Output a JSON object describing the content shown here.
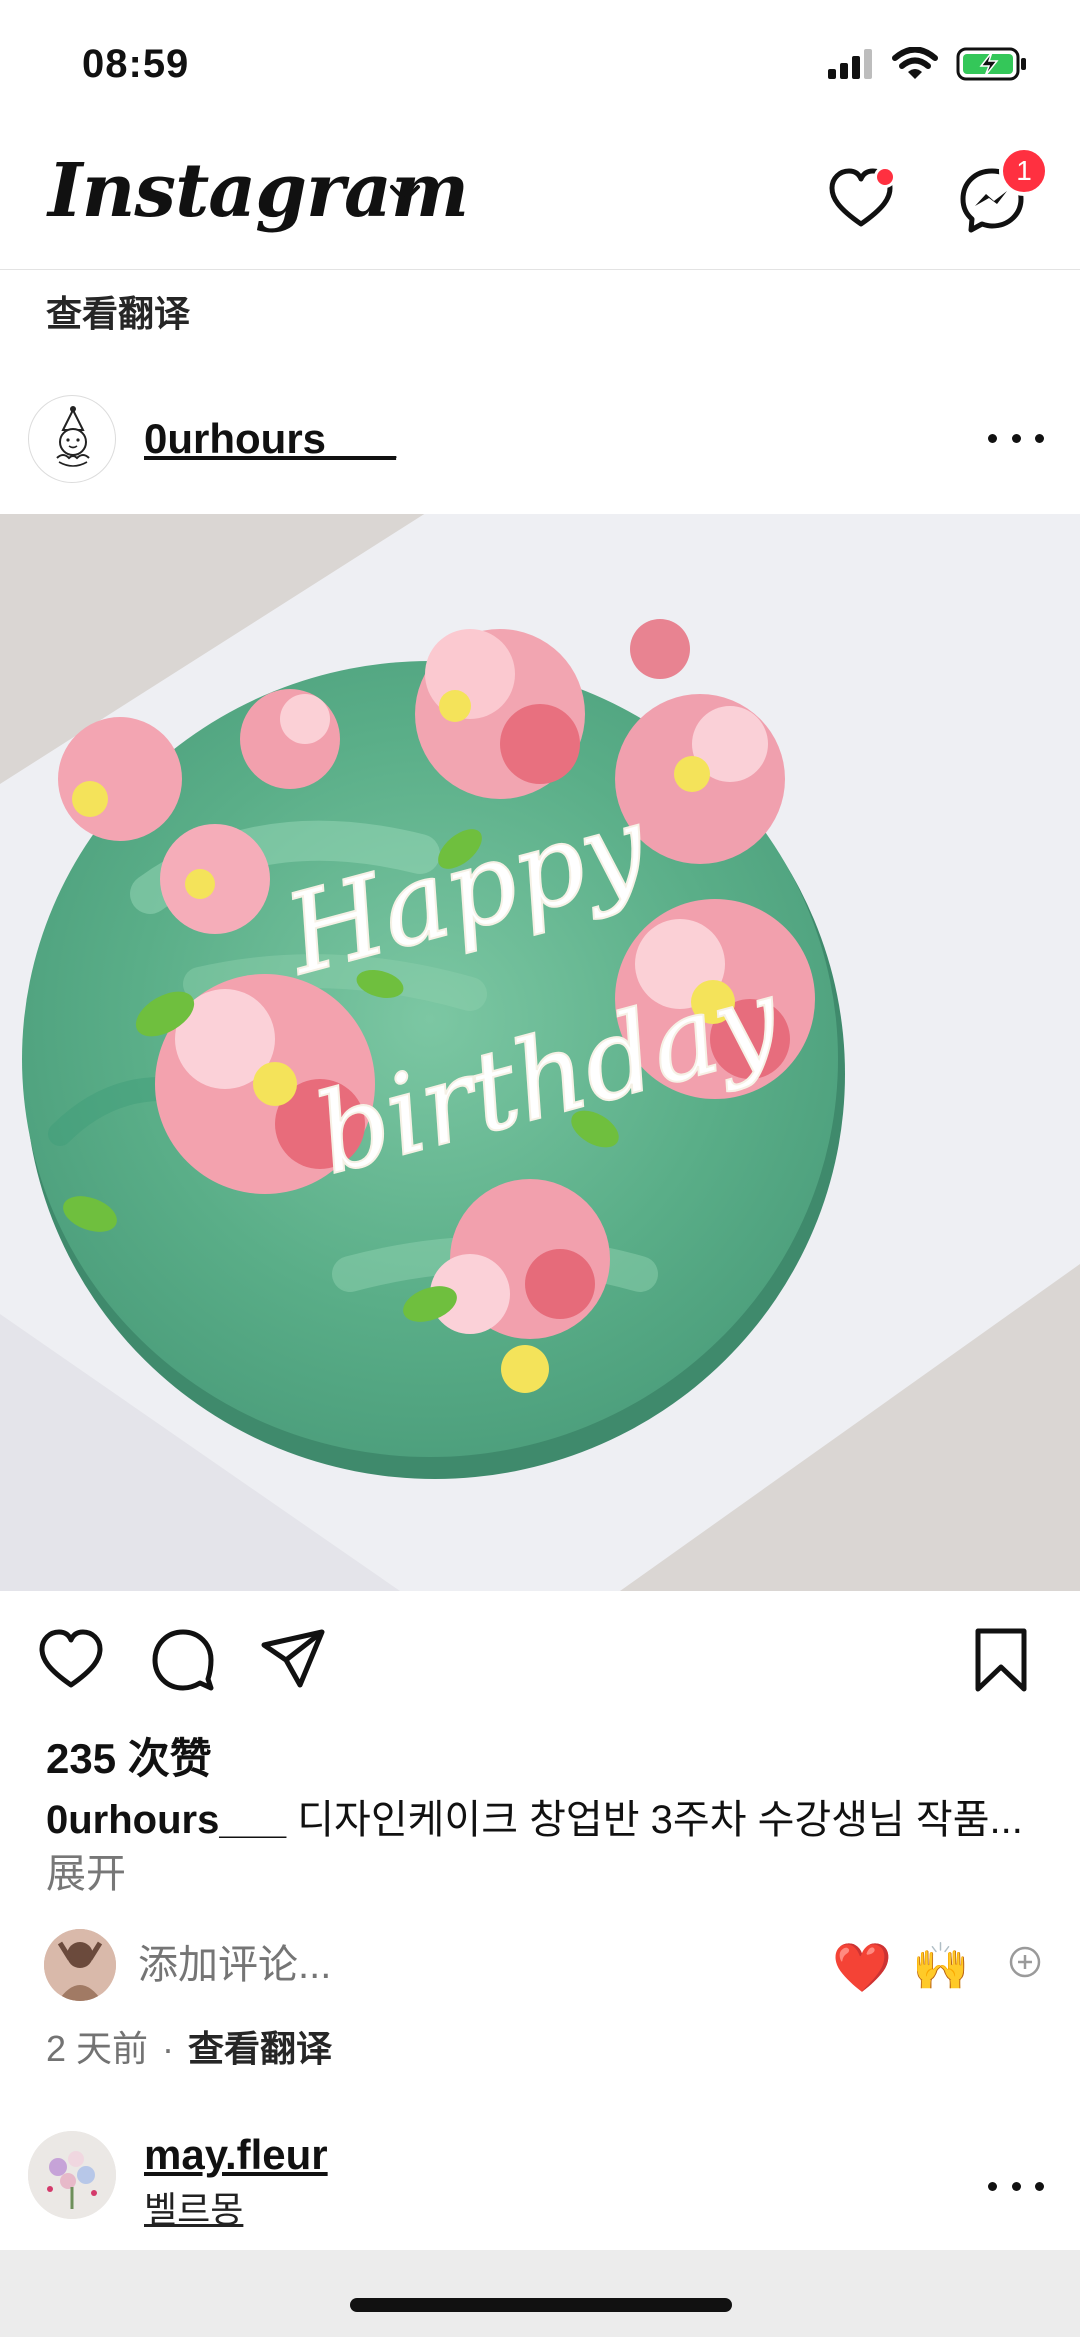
{
  "status_bar": {
    "time": "08:59"
  },
  "header": {
    "logo": "Instagram",
    "messenger_badge": "1"
  },
  "translate_top": "查看翻译",
  "post": {
    "username": "0urhours___",
    "likes": "235 次赞",
    "caption_user": "0urhours___",
    "caption_text": " 디자인케이크 창업반 3주차 수강생님 작품...",
    "caption_more": " 展开",
    "image_text_line1": "Happy",
    "image_text_line2": "birthday",
    "comment_placeholder": "添加评论...",
    "emoji_heart": "❤️",
    "emoji_hands": "🙌",
    "time_ago": "2 天前",
    "separator": "·",
    "see_translation": "查看翻译"
  },
  "next_post": {
    "username": "may.fleur",
    "subtitle": "벨르몽"
  },
  "colors": {
    "badge": "#ff3040",
    "cake_green": "#5fb68f",
    "flower_pink": "#ee8a98"
  }
}
